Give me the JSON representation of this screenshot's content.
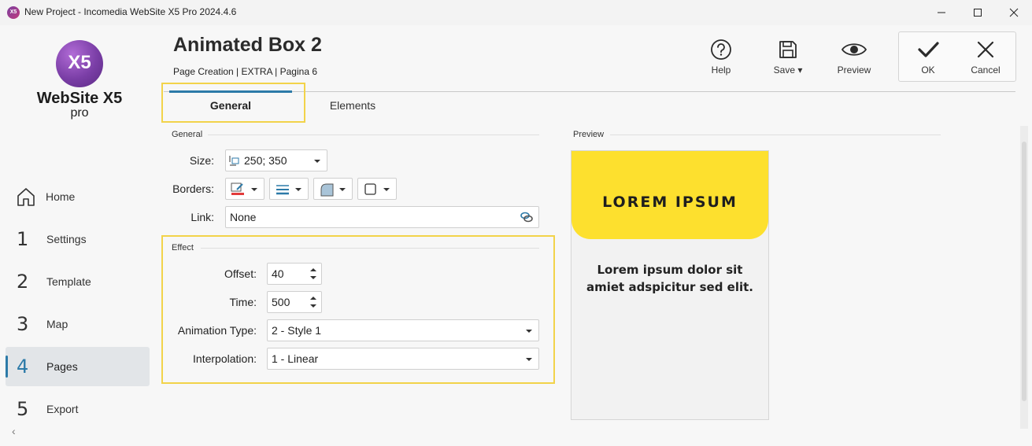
{
  "window": {
    "title": "New Project - Incomedia WebSite X5 Pro 2024.4.6",
    "app_icon_text": "X5"
  },
  "logo": {
    "mark": "X5",
    "name": "WebSite X5",
    "edition": "pro"
  },
  "sidebar": {
    "items": [
      {
        "num": "",
        "label": "Home",
        "icon": "home-icon",
        "active": false
      },
      {
        "num": "1",
        "label": "Settings",
        "active": false
      },
      {
        "num": "2",
        "label": "Template",
        "active": false
      },
      {
        "num": "3",
        "label": "Map",
        "active": false
      },
      {
        "num": "4",
        "label": "Pages",
        "active": true
      },
      {
        "num": "5",
        "label": "Export",
        "active": false
      }
    ],
    "collapse_glyph": "‹"
  },
  "header": {
    "title": "Animated Box 2",
    "breadcrumb": "Page Creation | EXTRA | Pagina 6"
  },
  "toolbar": {
    "help_label": "Help",
    "save_label": "Save ▾",
    "preview_label": "Preview",
    "ok_label": "OK",
    "cancel_label": "Cancel"
  },
  "tabs": [
    {
      "label": "General",
      "active": true
    },
    {
      "label": "Elements",
      "active": false
    }
  ],
  "general": {
    "section_title": "General",
    "size_label": "Size:",
    "size_value": "250; 350",
    "borders_label": "Borders:",
    "link_label": "Link:",
    "link_value": "None"
  },
  "effect": {
    "section_title": "Effect",
    "offset_label": "Offset:",
    "offset_value": "40",
    "time_label": "Time:",
    "time_value": "500",
    "animation_type_label": "Animation Type:",
    "animation_type_value": "2 - Style 1",
    "interpolation_label": "Interpolation:",
    "interpolation_value": "1 - Linear"
  },
  "preview": {
    "section_title": "Preview",
    "headline": "LOREM IPSUM",
    "body": "Lorem ipsum dolor sit amiet adspicitur sed elit.",
    "header_color": "#fde02e"
  },
  "colors": {
    "accent": "#2c7aa8",
    "highlight": "#f2d34a"
  }
}
